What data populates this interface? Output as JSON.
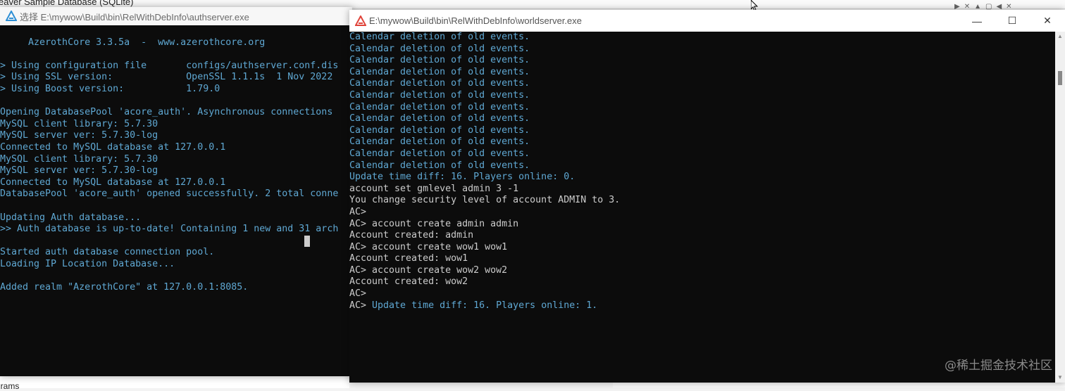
{
  "background": {
    "title_fragment": "eaver Sample Database (SQLite)",
    "bottom_fragment": "grams"
  },
  "auth_window": {
    "title": "选择 E:\\mywow\\Build\\bin\\RelWithDebInfo\\authserver.exe",
    "lines": [
      {
        "text": "",
        "color": "gray"
      },
      {
        "text": "     AzerothCore 3.3.5a  -  www.azerothcore.org",
        "color": "cyan"
      },
      {
        "text": "",
        "color": "gray"
      },
      {
        "text": "> Using configuration file       configs/authserver.conf.dis",
        "color": "cyan"
      },
      {
        "text": "> Using SSL version:             OpenSSL 1.1.1s  1 Nov 2022",
        "color": "cyan"
      },
      {
        "text": "> Using Boost version:           1.79.0",
        "color": "cyan"
      },
      {
        "text": "",
        "color": "gray"
      },
      {
        "text": "Opening DatabasePool 'acore_auth'. Asynchronous connections",
        "color": "cyan"
      },
      {
        "text": "MySQL client library: 5.7.30",
        "color": "cyan"
      },
      {
        "text": "MySQL server ver: 5.7.30-log",
        "color": "cyan"
      },
      {
        "text": "Connected to MySQL database at 127.0.0.1",
        "color": "cyan"
      },
      {
        "text": "MySQL client library: 5.7.30",
        "color": "cyan"
      },
      {
        "text": "MySQL server ver: 5.7.30-log",
        "color": "cyan"
      },
      {
        "text": "Connected to MySQL database at 127.0.0.1",
        "color": "cyan"
      },
      {
        "text": "DatabasePool 'acore_auth' opened successfully. 2 total conne",
        "color": "cyan"
      },
      {
        "text": "",
        "color": "gray"
      },
      {
        "text": "Updating Auth database...",
        "color": "cyan"
      },
      {
        "text": ">> Auth database is up-to-date! Containing 1 new and 31 arch",
        "color": "cyan"
      },
      {
        "text": "",
        "color": "gray",
        "cursor": true
      },
      {
        "text": "Started auth database connection pool.",
        "color": "cyan"
      },
      {
        "text": "Loading IP Location Database...",
        "color": "cyan"
      },
      {
        "text": "",
        "color": "gray"
      },
      {
        "text": "Added realm \"AzerothCore\" at 127.0.0.1:8085.",
        "color": "cyan"
      }
    ]
  },
  "world_window": {
    "title": "E:\\mywow\\Build\\bin\\RelWithDebInfo\\worldserver.exe",
    "controls": {
      "minimize": "—",
      "maximize": "☐",
      "close": "✕"
    },
    "lines": [
      {
        "text": "Calendar deletion of old events.",
        "color": "cyan"
      },
      {
        "text": "Calendar deletion of old events.",
        "color": "cyan"
      },
      {
        "text": "Calendar deletion of old events.",
        "color": "cyan"
      },
      {
        "text": "Calendar deletion of old events.",
        "color": "cyan"
      },
      {
        "text": "Calendar deletion of old events.",
        "color": "cyan"
      },
      {
        "text": "Calendar deletion of old events.",
        "color": "cyan"
      },
      {
        "text": "Calendar deletion of old events.",
        "color": "cyan"
      },
      {
        "text": "Calendar deletion of old events.",
        "color": "cyan"
      },
      {
        "text": "Calendar deletion of old events.",
        "color": "cyan"
      },
      {
        "text": "Calendar deletion of old events.",
        "color": "cyan"
      },
      {
        "text": "Calendar deletion of old events.",
        "color": "cyan"
      },
      {
        "text": "Calendar deletion of old events.",
        "color": "cyan"
      },
      {
        "text": "Update time diff: 16. Players online: 0.",
        "color": "cyan"
      },
      {
        "text": "account set gmlevel admin 3 -1",
        "color": "gray"
      },
      {
        "text": "You change security level of account ADMIN to 3.",
        "color": "gray"
      },
      {
        "text": "AC>",
        "color": "gray"
      },
      {
        "text": "AC> account create admin admin",
        "color": "gray"
      },
      {
        "text": "Account created: admin",
        "color": "gray"
      },
      {
        "text": "AC> account create wow1 wow1",
        "color": "gray"
      },
      {
        "text": "Account created: wow1",
        "color": "gray"
      },
      {
        "text": "AC> account create wow2 wow2",
        "color": "gray"
      },
      {
        "text": "Account created: wow2",
        "color": "gray"
      },
      {
        "text": "AC>",
        "color": "gray"
      },
      {
        "prompt": "AC> ",
        "text": "Update time diff: 16. Players online: 1.",
        "color": "cyan"
      }
    ]
  },
  "watermark": "@稀土掘金技术社区",
  "colors": {
    "gray": "#cccccc",
    "cyan": "#5fa8d3",
    "console_bg": "#0c0c0c"
  }
}
